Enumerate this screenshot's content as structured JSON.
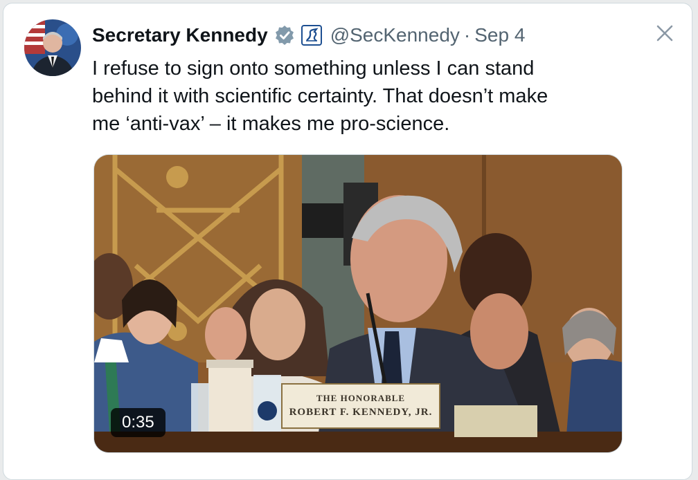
{
  "tweet": {
    "display_name": "Secretary Kennedy",
    "handle": "@SecKennedy",
    "separator": "·",
    "date": "Sep 4",
    "text_lines": [
      "I refuse to sign onto something unless I can stand",
      "behind it with scientific certainty. That doesn’t make",
      "me ‘anti-vax’ – it makes me pro-science."
    ]
  },
  "video": {
    "duration": "0:35",
    "nameplate_line1": "THE HONORABLE",
    "nameplate_line2": "ROBERT F. KENNEDY, JR."
  },
  "icons": {
    "verified": "verified-badge-icon",
    "affiliate": "hhs-affiliation-icon",
    "close": "close-icon"
  },
  "colors": {
    "verified_badge": "#829aab",
    "affiliate_badge": "#1d4f91",
    "secondary_text": "#536471",
    "border": "#cfd9de"
  }
}
